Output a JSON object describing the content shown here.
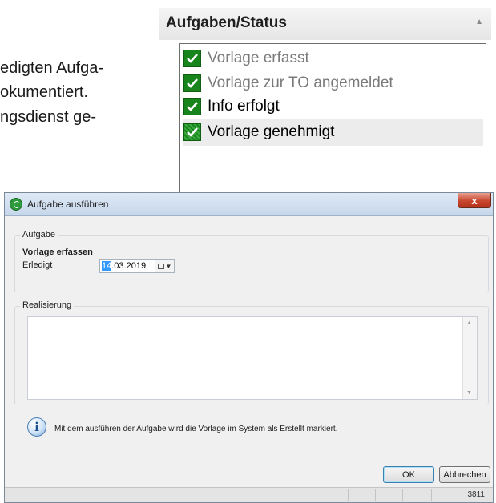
{
  "document": {
    "lines": [
      "edigten Aufga-",
      "okumentiert.",
      "ngsdienst ge-"
    ]
  },
  "panel": {
    "title": "Aufgaben/Status",
    "tasks": [
      {
        "label": "Vorlage erfasst",
        "checked": true,
        "color": "#7a7a7a",
        "bold": false
      },
      {
        "label": "Vorlage zur TO angemeldet",
        "checked": true,
        "color": "#7a7a7a",
        "bold": false
      },
      {
        "label": "Info erfolgt",
        "checked": true,
        "color": "#000000",
        "bold": false
      },
      {
        "label": "Vorlage genehmigt",
        "checked": true,
        "color": "#000000",
        "bold": false,
        "selected": true
      }
    ]
  },
  "dialog": {
    "title": "Aufgabe ausführen",
    "close_label": "x",
    "aufgabe_group": {
      "legend": "Aufgabe",
      "task_name": "Vorlage erfassen",
      "erledigt_label": "Erledigt",
      "date_day": "14",
      "date_rest": ".03.2019"
    },
    "realisierung_group": {
      "legend": "Realisierung",
      "memo_value": ""
    },
    "info_message": "Mit dem ausführen der Aufgabe wird die Vorlage im System als Erstellt markiert.",
    "ok_label": "OK",
    "cancel_label": "Abbrechen",
    "status_code": "3811"
  },
  "colors": {
    "check_green": "#18841c",
    "close_red": "#c8452e",
    "selection_blue": "#3399ff"
  }
}
